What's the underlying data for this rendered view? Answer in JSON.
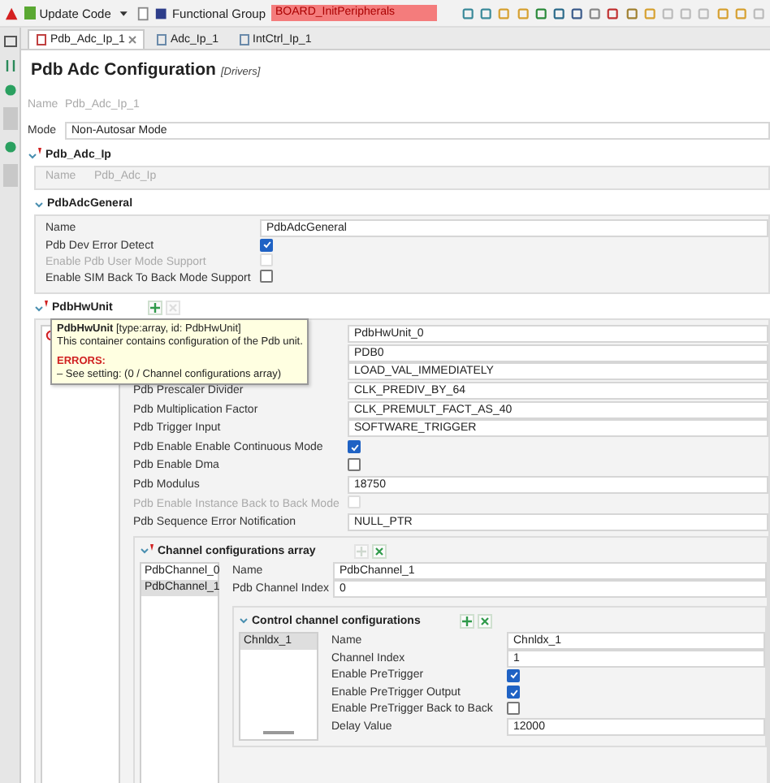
{
  "toolbar": {
    "update_button": "Update Code",
    "group_label": "Functional Group",
    "group_value": "BOARD_InitPeripherals"
  },
  "tabs": [
    {
      "label": "Pdb_Adc_Ip_1",
      "selected": true
    },
    {
      "label": "Adc_Ip_1",
      "selected": false
    },
    {
      "label": "IntCtrl_Ip_1",
      "selected": false
    }
  ],
  "header": {
    "title": "Pdb Adc Configuration",
    "subtitle": "[Drivers]"
  },
  "top_fields": [
    {
      "kind": "text",
      "label": "Name",
      "value": "Pdb_Adc_Ip_1",
      "disabled": true
    },
    {
      "kind": "text",
      "label": "Mode",
      "value": "Non-Autosar Mode",
      "disabled": false
    }
  ],
  "component": {
    "title": "Pdb_Adc_Ip",
    "expanded": true,
    "error": true,
    "fields": [
      {
        "kind": "text",
        "label": "Name",
        "value": "Pdb_Adc_Ip",
        "disabled": true
      }
    ],
    "general": {
      "title": "PdbAdcGeneral",
      "expanded": true,
      "error": false,
      "fields": [
        {
          "kind": "text",
          "label": "Name",
          "value": "PdbAdcGeneral",
          "disabled": false
        },
        {
          "kind": "check",
          "label": "Pdb Dev Error Detect",
          "checked": true,
          "disabled": false
        },
        {
          "kind": "check",
          "label": "Enable Pdb User Mode Support",
          "checked": false,
          "disabled": true
        },
        {
          "kind": "check",
          "label": "Enable SIM Back To Back Mode Support",
          "checked": false,
          "disabled": false
        }
      ]
    },
    "hw_unit": {
      "title": "PdbHwUnit",
      "expanded": true,
      "error": true,
      "can_add": true,
      "can_remove": false,
      "list": [
        {
          "error": true
        }
      ],
      "tooltip": {
        "heading": "**PdbHwUnit** [type:array, id: PdbHwUnit]",
        "text": "This container contains configuration of the Pdb unit.",
        "errors_title": "ERRORS:",
        "errors": [
          "– See setting: (0 / Channel configurations array)"
        ]
      },
      "fields": [
        {
          "kind": "text",
          "value": "PdbHwUnit_0",
          "disabled": false
        },
        {
          "kind": "text",
          "value": "PDB0",
          "disabled": false
        },
        {
          "kind": "text",
          "value": "LOAD_VAL_IMMEDIATELY",
          "disabled": false
        },
        {
          "kind": "text",
          "label": "Pdb Prescaler Divider",
          "value": "CLK_PREDIV_BY_64",
          "disabled": false
        },
        {
          "kind": "text",
          "label": "Pdb Multiplication Factor",
          "value": "CLK_PREMULT_FACT_AS_40",
          "disabled": false
        },
        {
          "kind": "text",
          "label": "Pdb Trigger Input",
          "value": "SOFTWARE_TRIGGER",
          "disabled": false
        },
        {
          "kind": "check",
          "label": "Pdb Enable Enable Continuous Mode",
          "checked": true,
          "disabled": false
        },
        {
          "kind": "check",
          "label": "Pdb Enable Dma",
          "checked": false,
          "disabled": false
        },
        {
          "kind": "text",
          "label": "Pdb Modulus",
          "value": "18750",
          "disabled": false
        },
        {
          "kind": "check",
          "label": "Pdb Enable Instance Back to Back Mode",
          "checked": false,
          "disabled": true
        },
        {
          "kind": "text",
          "label": "Pdb Sequence Error Notification",
          "value": "NULL_PTR",
          "disabled": false
        }
      ],
      "channels": {
        "title": "Channel configurations array",
        "expanded": true,
        "error": true,
        "can_add": false,
        "can_remove": true,
        "list": [
          {
            "label": "PdbChannel_0",
            "selected": false
          },
          {
            "label": "PdbChannel_1",
            "selected": true
          }
        ],
        "fields": [
          {
            "kind": "text",
            "label": "Name",
            "value": "PdbChannel_1",
            "disabled": false
          },
          {
            "kind": "text",
            "label": "Pdb Channel Index",
            "value": "0",
            "disabled": false
          }
        ],
        "control": {
          "title": "Control channel configurations",
          "expanded": true,
          "error": false,
          "can_add": true,
          "can_remove": true,
          "list": [
            {
              "label": "Chnldx_1",
              "selected": true
            }
          ],
          "fields": [
            {
              "kind": "text",
              "label": "Name",
              "value": "Chnldx_1",
              "disabled": false
            },
            {
              "kind": "text",
              "label": "Channel Index",
              "value": "1",
              "disabled": false
            },
            {
              "kind": "check",
              "label": "Enable PreTrigger",
              "checked": true,
              "disabled": false
            },
            {
              "kind": "check",
              "label": "Enable PreTrigger Output",
              "checked": true,
              "disabled": false
            },
            {
              "kind": "check",
              "label": "Enable PreTrigger Back to Back",
              "checked": false,
              "disabled": false
            },
            {
              "kind": "text",
              "label": "Delay Value",
              "value": "12000",
              "disabled": false
            }
          ]
        }
      }
    }
  }
}
